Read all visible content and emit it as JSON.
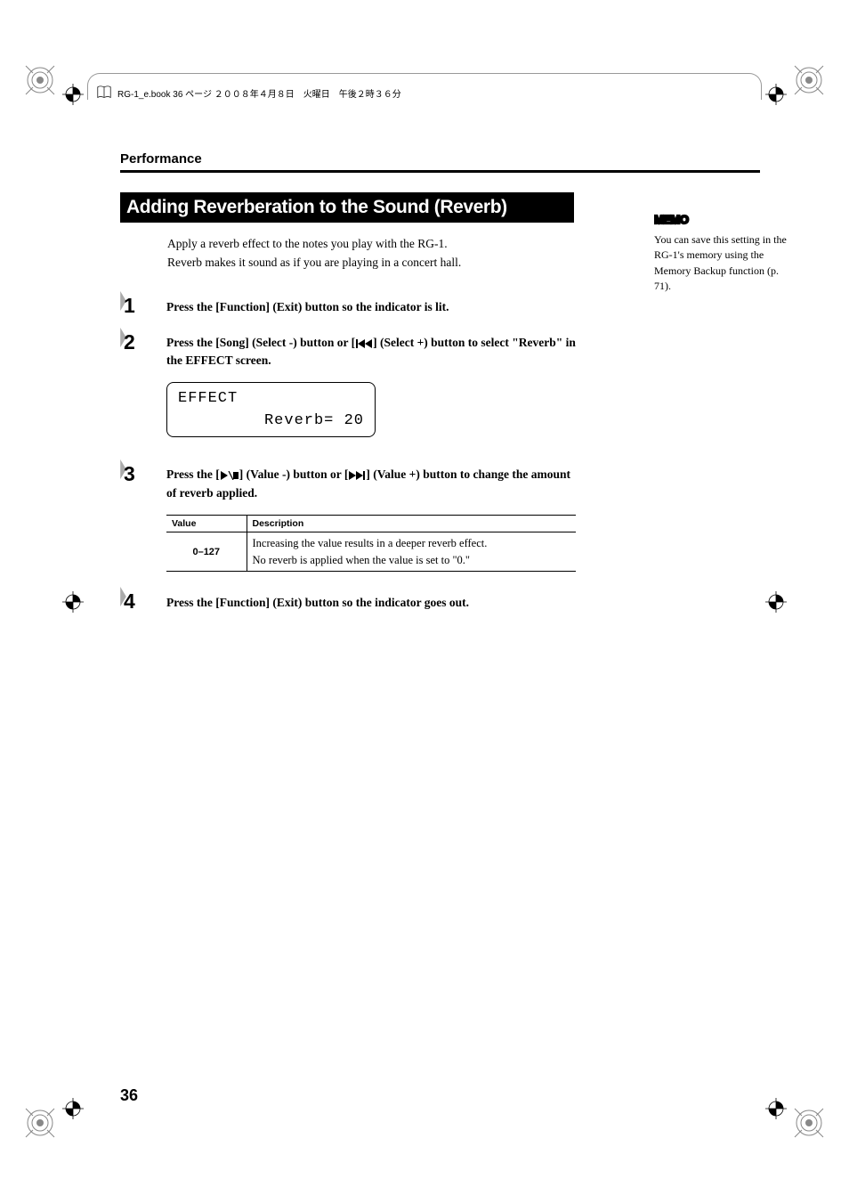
{
  "page_header": "RG-1_e.book 36 ページ ２００８年４月８日　火曜日　午後２時３６分",
  "section_title": "Performance",
  "main_heading": "Adding Reverberation to the Sound (Reverb)",
  "intro_line1": "Apply a reverb effect to the notes you play with the RG-1.",
  "intro_line2": "Reverb makes it sound as if you are playing in a concert hall.",
  "memo_label": "MEMO",
  "memo_text": "You can save this setting in the RG-1's memory using the Memory Backup function (p. 71).",
  "steps": {
    "s1": {
      "num": "1",
      "text": "Press the [Function] (Exit) button so the indicator is lit."
    },
    "s2": {
      "num": "2",
      "text_pre": "Press the [Song] (Select -) button or [",
      "text_post": "] (Select +) button to select \"Reverb\" in the EFFECT screen."
    },
    "s3": {
      "num": "3",
      "text_pre": "Press the [",
      "text_mid": "] (Value -) button or [",
      "text_post": "] (Value +) button to change the amount of reverb applied."
    },
    "s4": {
      "num": "4",
      "text": "Press the [Function] (Exit) button so the indicator goes out."
    }
  },
  "lcd": {
    "line1": "EFFECT",
    "line2": "Reverb= 20"
  },
  "table": {
    "header_value": "Value",
    "header_desc": "Description",
    "row1_value": "0–127",
    "row1_desc_l1": "Increasing the value results in a deeper reverb effect.",
    "row1_desc_l2": "No reverb is applied when the value is set to \"0.\""
  },
  "page_number": "36"
}
